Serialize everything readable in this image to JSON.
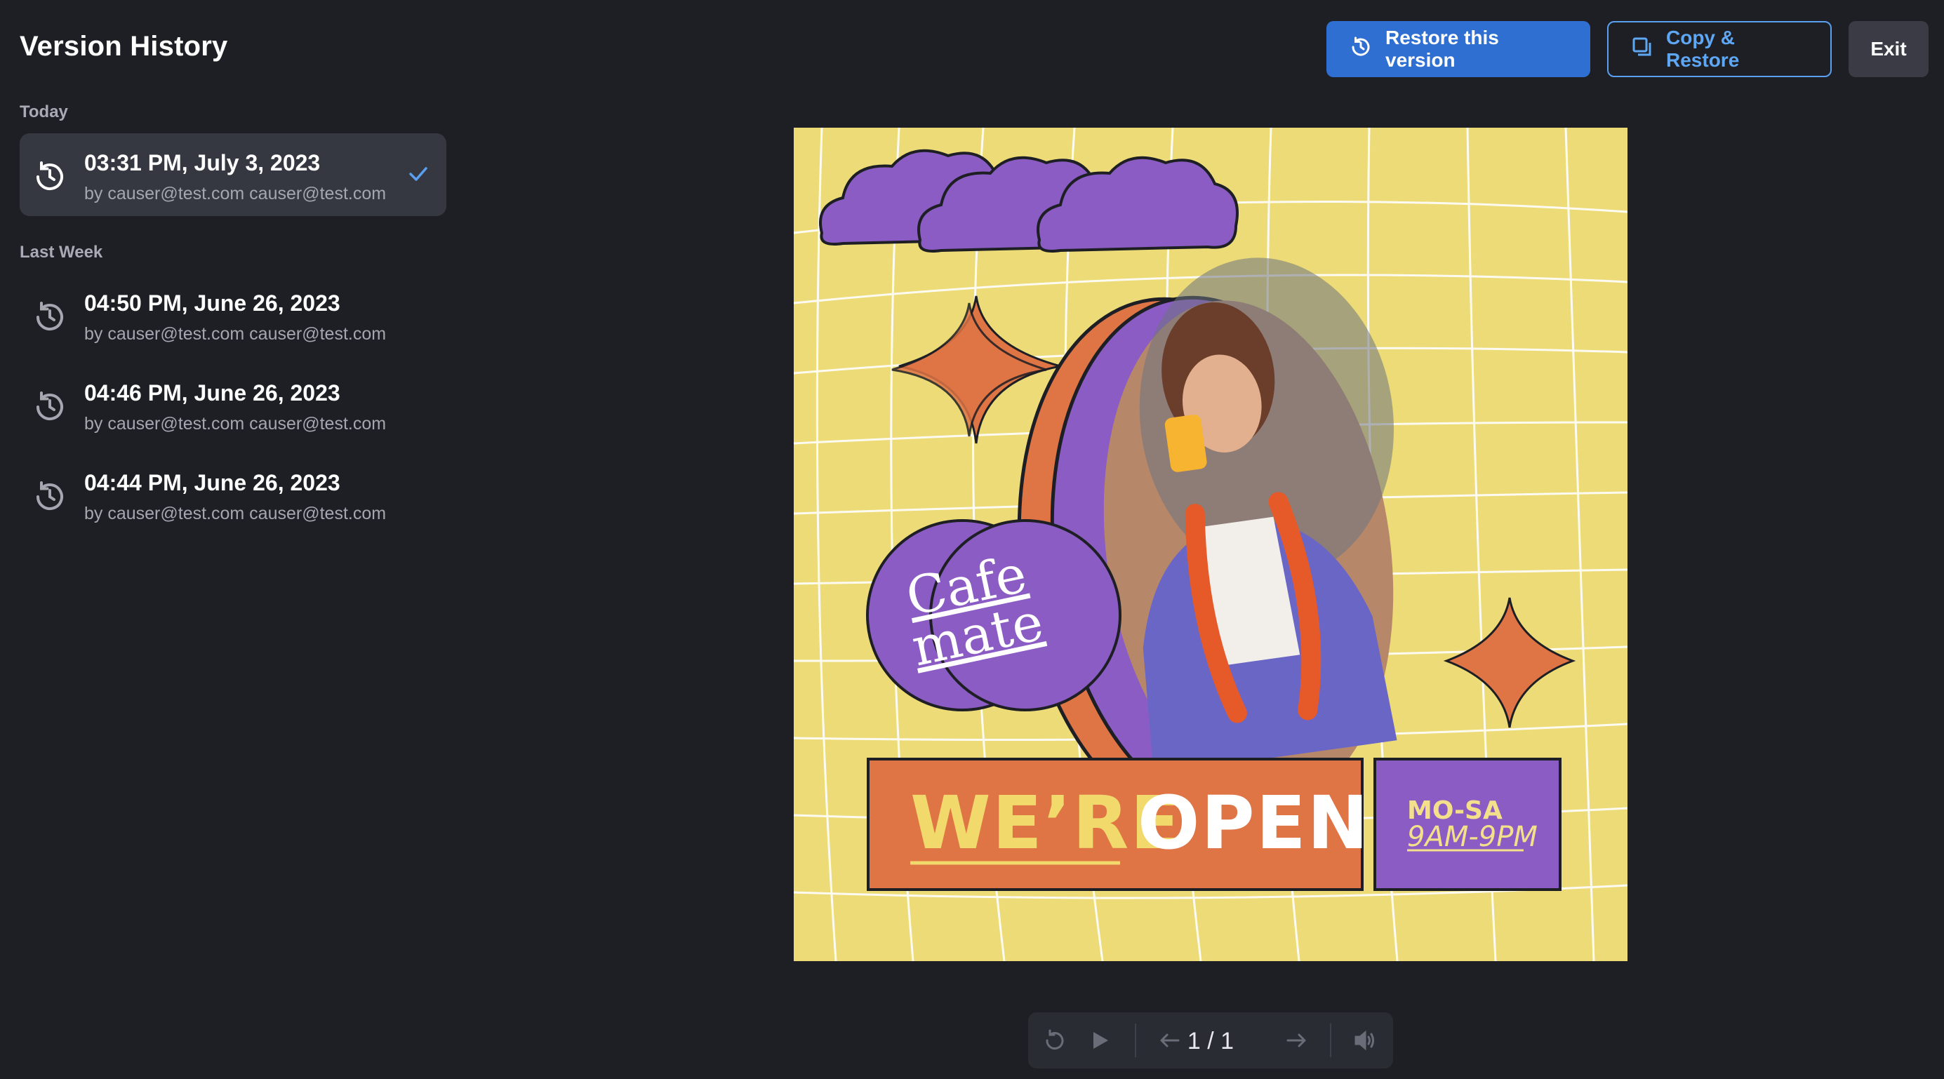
{
  "header": {
    "title": "Version History",
    "restore_label": "Restore this version",
    "copy_restore_label": "Copy & Restore",
    "exit_label": "Exit"
  },
  "sidebar": {
    "sections": [
      {
        "label": "Today",
        "items": [
          {
            "title": "03:31 PM, July 3, 2023",
            "author": "by causer@test.com causer@test.com",
            "selected": true
          }
        ]
      },
      {
        "label": "Last Week",
        "items": [
          {
            "title": "04:50 PM, June 26, 2023",
            "author": "by causer@test.com causer@test.com",
            "selected": false
          },
          {
            "title": "04:46 PM, June 26, 2023",
            "author": "by causer@test.com causer@test.com",
            "selected": false
          },
          {
            "title": "04:44 PM, June 26, 2023",
            "author": "by causer@test.com causer@test.com",
            "selected": false
          }
        ]
      }
    ]
  },
  "design": {
    "brand_line1": "Cafe",
    "brand_line2": "mate",
    "banner_part1": "WE’RE",
    "banner_part2": "OPEN",
    "days": "MO-SA",
    "hours": "9AM-9PM"
  },
  "player": {
    "page_indicator": "1 / 1"
  },
  "colors": {
    "background": "#1e1f25",
    "primary": "#2f6fd1",
    "accent_outline": "#5aa0ef",
    "poster_yellow": "#ecdb77",
    "poster_orange": "#df7445",
    "poster_purple": "#8a5cc4"
  }
}
